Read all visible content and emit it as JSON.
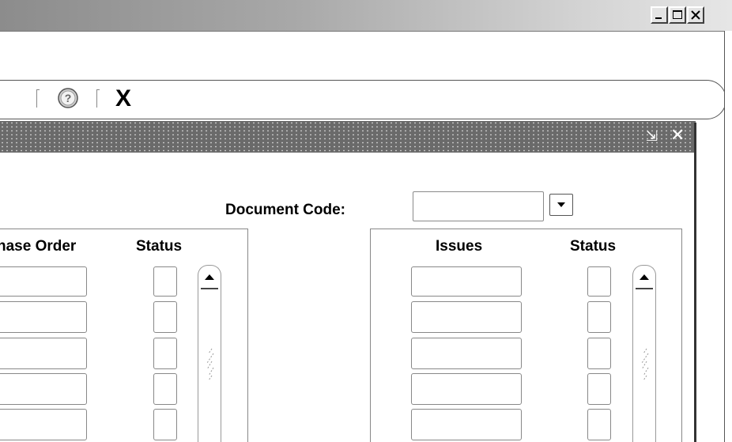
{
  "window": {
    "controls": {
      "minimize_icon": "minimize-icon",
      "maximize_icon": "maximize-icon",
      "close_icon": "close-icon"
    }
  },
  "toolbar": {
    "help_icon": "help-icon",
    "exit_label": "X"
  },
  "form": {
    "minimize_glyph": "⇲",
    "close_glyph": "✕",
    "document_code": {
      "label": "Document Code:",
      "value": ""
    },
    "left_block": {
      "col1_header": "hase Order",
      "col2_header": "Status",
      "rows": [
        {
          "value": "",
          "status": ""
        },
        {
          "value": "",
          "status": ""
        },
        {
          "value": "",
          "status": ""
        },
        {
          "value": "",
          "status": ""
        },
        {
          "value": "",
          "status": ""
        }
      ]
    },
    "right_block": {
      "col1_header": "Issues",
      "col2_header": "Status",
      "rows": [
        {
          "value": "",
          "status": ""
        },
        {
          "value": "",
          "status": ""
        },
        {
          "value": "",
          "status": ""
        },
        {
          "value": "",
          "status": ""
        },
        {
          "value": "",
          "status": ""
        }
      ]
    }
  }
}
